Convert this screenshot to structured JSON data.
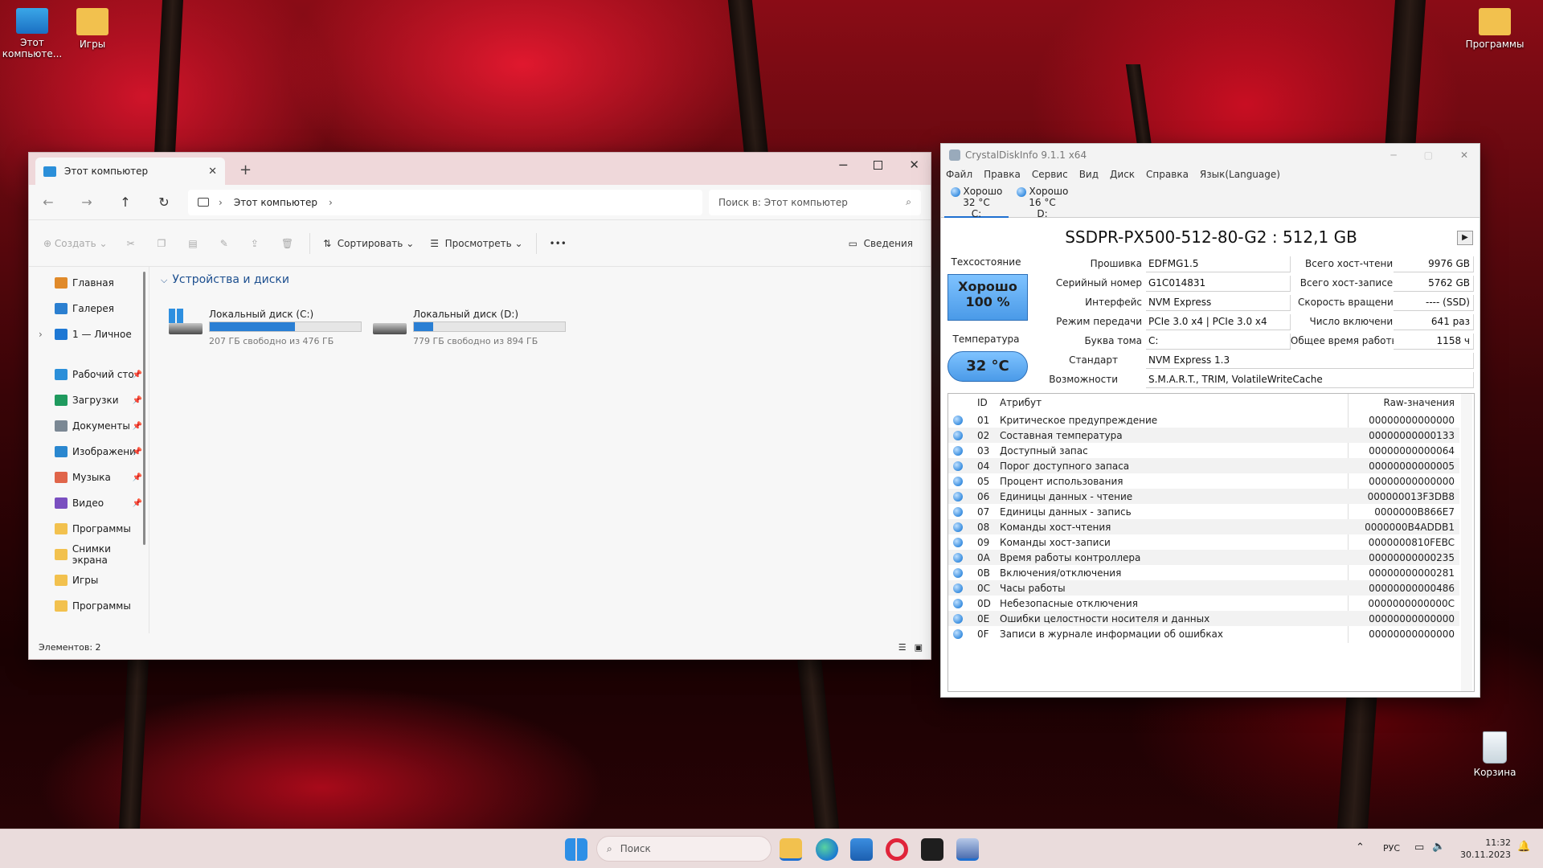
{
  "desktop": {
    "icons_left": [
      {
        "label": "Этот компьюте..."
      },
      {
        "label": "Игры"
      }
    ],
    "icon_right_top": "Программы",
    "recycle": "Корзина"
  },
  "explorer": {
    "tab_title": "Этот компьютер",
    "breadcrumb": "Этот компьютер",
    "search_placeholder": "Поиск в: Этот компьютер",
    "toolbar": {
      "create": "Создать",
      "sort": "Сортировать",
      "view": "Просмотреть",
      "more": "•••",
      "details": "Сведения"
    },
    "sidebar": [
      {
        "label": "Главная",
        "icon": "home-icon",
        "pinned": false
      },
      {
        "label": "Галерея",
        "icon": "gallery-icon",
        "pinned": false
      },
      {
        "label": "1 — Личное",
        "icon": "cloud-icon",
        "pinned": false
      },
      {
        "label": "Рабочий сто",
        "icon": "desktop-icon",
        "pinned": true
      },
      {
        "label": "Загрузки",
        "icon": "download-icon",
        "pinned": true
      },
      {
        "label": "Документы",
        "icon": "document-icon",
        "pinned": true
      },
      {
        "label": "Изображени",
        "icon": "pictures-icon",
        "pinned": true
      },
      {
        "label": "Музыка",
        "icon": "music-icon",
        "pinned": true
      },
      {
        "label": "Видео",
        "icon": "video-icon",
        "pinned": true
      },
      {
        "label": "Программы",
        "icon": "folder-icon",
        "pinned": false
      },
      {
        "label": "Снимки экрана",
        "icon": "folder-icon",
        "pinned": false
      },
      {
        "label": "Игры",
        "icon": "folder-icon",
        "pinned": false
      },
      {
        "label": "Программы",
        "icon": "folder-icon",
        "pinned": false
      }
    ],
    "section": "Устройства и диски",
    "drives": [
      {
        "name": "Локальный диск (C:)",
        "free": "207 ГБ свободно из 476 ГБ",
        "used_fraction": 0.565
      },
      {
        "name": "Локальный диск (D:)",
        "free": "779 ГБ свободно из 894 ГБ",
        "used_fraction": 0.129
      }
    ],
    "status": "Элементов: 2"
  },
  "cdi": {
    "title": "CrystalDiskInfo 9.1.1 x64",
    "menu": [
      "Файл",
      "Правка",
      "Сервис",
      "Вид",
      "Диск",
      "Справка",
      "Язык(Language)"
    ],
    "disks": [
      {
        "status": "Хорошо",
        "temp": "32 °C",
        "letter": "C:"
      },
      {
        "status": "Хорошо",
        "temp": "16 °C",
        "letter": "D:"
      }
    ],
    "model": "SSDPR-PX500-512-80-G2 : 512,1 GB",
    "health_label": "Техсостояние",
    "health_status": "Хорошо",
    "health_pct": "100 %",
    "temp_label": "Температура",
    "temp_value": "32 °C",
    "fields_left": [
      {
        "label": "Прошивка",
        "value": "EDFMG1.5"
      },
      {
        "label": "Серийный номер",
        "value": "G1C014831"
      },
      {
        "label": "Интерфейс",
        "value": "NVM Express"
      },
      {
        "label": "Режим передачи",
        "value": "PCIe 3.0 x4 | PCIe 3.0 x4"
      },
      {
        "label": "Буква тома",
        "value": "C:"
      }
    ],
    "fields_right": [
      {
        "label": "Всего хост-чтений",
        "value": "9976 GB"
      },
      {
        "label": "Всего хост-записей",
        "value": "5762 GB"
      },
      {
        "label": "Скорость вращения",
        "value": "---- (SSD)"
      },
      {
        "label": "Число включений",
        "value": "641 раз"
      },
      {
        "label": "Общее время работы",
        "value": "1158 ч"
      }
    ],
    "standard_label": "Стандарт",
    "standard": "NVM Express 1.3",
    "features_label": "Возможности",
    "features": "S.M.A.R.T., TRIM, VolatileWriteCache",
    "smart_headers": {
      "id": "ID",
      "attr": "Атрибут",
      "raw": "Raw-значения"
    },
    "smart": [
      {
        "id": "01",
        "name": "Критическое предупреждение",
        "raw": "00000000000000"
      },
      {
        "id": "02",
        "name": "Составная температура",
        "raw": "00000000000133"
      },
      {
        "id": "03",
        "name": "Доступный запас",
        "raw": "00000000000064"
      },
      {
        "id": "04",
        "name": "Порог доступного запаса",
        "raw": "00000000000005"
      },
      {
        "id": "05",
        "name": "Процент использования",
        "raw": "00000000000000"
      },
      {
        "id": "06",
        "name": "Единицы данных - чтение",
        "raw": "000000013F3DB8"
      },
      {
        "id": "07",
        "name": "Единицы данных - запись",
        "raw": "0000000B866E7"
      },
      {
        "id": "08",
        "name": "Команды хост-чтения",
        "raw": "0000000B4ADDB1"
      },
      {
        "id": "09",
        "name": "Команды хост-записи",
        "raw": "0000000810FEBC"
      },
      {
        "id": "0A",
        "name": "Время работы контроллера",
        "raw": "00000000000235"
      },
      {
        "id": "0B",
        "name": "Включения/отключения",
        "raw": "00000000000281"
      },
      {
        "id": "0C",
        "name": "Часы работы",
        "raw": "00000000000486"
      },
      {
        "id": "0D",
        "name": "Небезопасные отключения",
        "raw": "0000000000000C"
      },
      {
        "id": "0E",
        "name": "Ошибки целостности носителя и данных",
        "raw": "00000000000000"
      },
      {
        "id": "0F",
        "name": "Записи в журнале информации об ошибках",
        "raw": "00000000000000"
      }
    ]
  },
  "taskbar": {
    "search": "Поиск",
    "lang": "РУС",
    "time": "11:32",
    "date": "30.11.2023"
  }
}
